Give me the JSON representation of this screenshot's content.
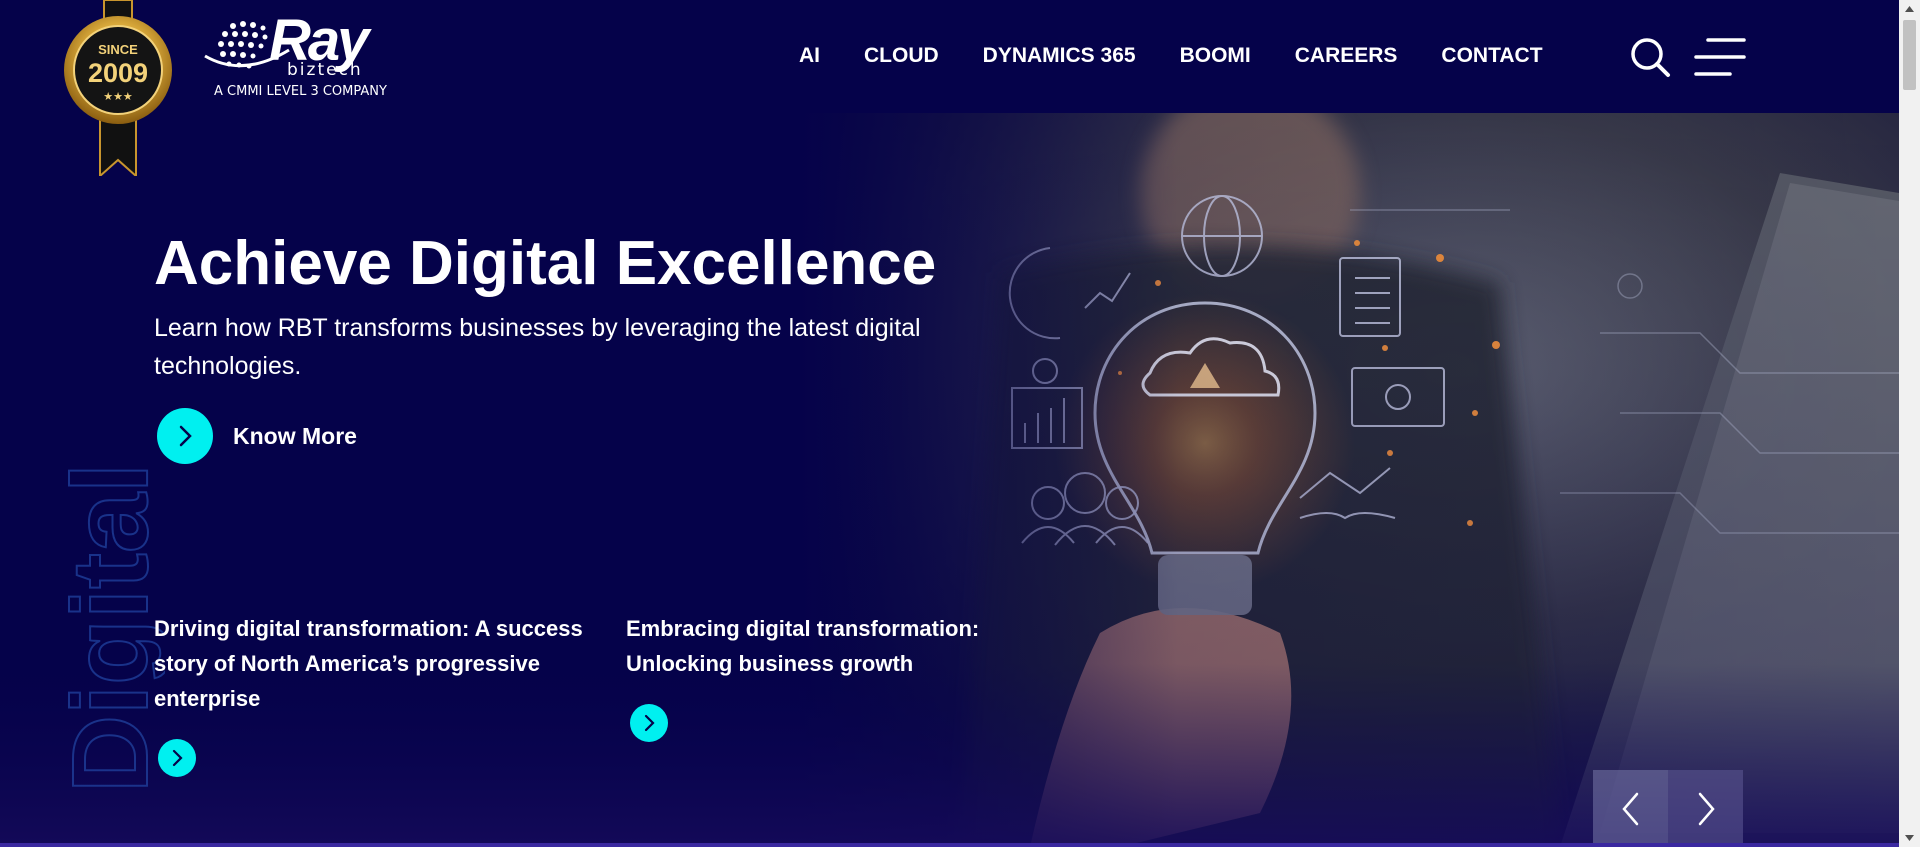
{
  "badge": {
    "since": "SINCE",
    "year": "2009",
    "stars": "★★★"
  },
  "logo": {
    "word": "Ray",
    "sub": "biztech",
    "tagline": "A CMMI LEVEL 3 COMPANY"
  },
  "nav": {
    "items": [
      "AI",
      "CLOUD",
      "DYNAMICS 365",
      "BOOMI",
      "CAREERS",
      "CONTACT"
    ]
  },
  "hero": {
    "background_word": "Digital",
    "title": "Achieve Digital Excellence",
    "subtitle": "Learn how RBT transforms businesses by leveraging the latest digital technologies.",
    "cta_label": "Know More",
    "stories": [
      "Driving digital transformation: A success story of North America’s progressive enterprise",
      "Embracing digital transformation: Unlocking business growth"
    ]
  },
  "colors": {
    "background": "#05024a",
    "accent_cyan": "#00f0f0",
    "gold": "#d4a53a"
  },
  "icons": [
    "search-icon",
    "hamburger-menu-icon",
    "chevron-right-icon",
    "chevron-left-icon"
  ]
}
